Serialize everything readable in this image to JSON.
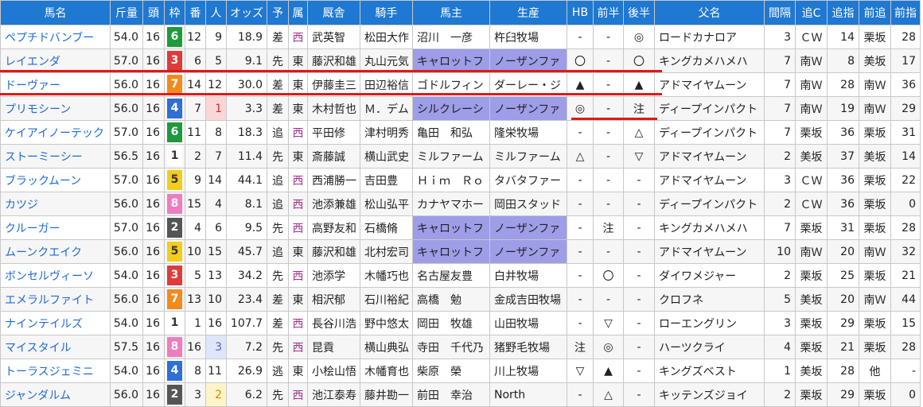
{
  "headers": [
    "馬名",
    "斤量",
    "頭",
    "枠",
    "番",
    "人",
    "オッズ",
    "予",
    "属",
    "厩舎",
    "騎手",
    "馬主",
    "生産",
    "HB",
    "前半",
    "後半",
    "父名",
    "間隔",
    "追C",
    "追指",
    "前追",
    "前指"
  ],
  "frame_colors": {
    "1": {
      "bg": "#ffffff",
      "fg": "#333333"
    },
    "2": {
      "bg": "#555555",
      "fg": "#ffffff"
    },
    "3": {
      "bg": "#e03a3a",
      "fg": "#ffffff"
    },
    "4": {
      "bg": "#2f6fd6",
      "fg": "#ffffff"
    },
    "5": {
      "bg": "#f3cc1c",
      "fg": "#333333"
    },
    "6": {
      "bg": "#1f9a3c",
      "fg": "#ffffff"
    },
    "7": {
      "bg": "#f28b1e",
      "fg": "#ffffff"
    },
    "8": {
      "bg": "#f07cc0",
      "fg": "#ffffff"
    }
  },
  "highlight_color": "#9d9de8",
  "horses": [
    {
      "name": "ペプチドバンブー",
      "kin": "54.0",
      "tou": "16",
      "waku": "6",
      "ban": "12",
      "nin": "9",
      "odds": "18.9",
      "yo": "差",
      "zoku": "西",
      "kyusha": "武英智",
      "kishu": "松田大作",
      "owner": "沼川　一彦",
      "breeder": "杵臼牧場",
      "hb": "-",
      "zen": "-",
      "kou": "◎",
      "sire": "ロードカナロア",
      "kankaku": "3",
      "oic": "ＣＷ",
      "oishi": "14",
      "maeoi": "栗坂",
      "maeshi": "28"
    },
    {
      "name": "レイエンダ",
      "kin": "57.0",
      "tou": "16",
      "waku": "3",
      "ban": "6",
      "nin": "5",
      "odds": "9.1",
      "yo": "先",
      "zoku": "東",
      "kyusha": "藤沢和雄",
      "kishu": "丸山元気",
      "owner": "キャロットフ",
      "breeder": "ノーザンファ",
      "hb": "〇",
      "zen": "-",
      "kou": "〇",
      "sire": "キングカメハメハ",
      "kankaku": "7",
      "oic": "南Ｗ",
      "oishi": "8",
      "maeoi": "美坂",
      "maeshi": "17",
      "hl_owner": true,
      "hl_breeder": true
    },
    {
      "name": "ドーヴァー",
      "kin": "56.0",
      "tou": "16",
      "waku": "7",
      "ban": "14",
      "nin": "12",
      "odds": "30.0",
      "yo": "差",
      "zoku": "東",
      "kyusha": "伊藤圭三",
      "kishu": "田辺裕信",
      "owner": "ゴドルフィン",
      "breeder": "ダーレー・ジ",
      "hb": "▲",
      "zen": "-",
      "kou": "▲",
      "sire": "アドマイヤムーン",
      "kankaku": "7",
      "oic": "南Ｗ",
      "oishi": "28",
      "maeoi": "南Ｗ",
      "maeshi": "36"
    },
    {
      "name": "プリモシーン",
      "kin": "56.0",
      "tou": "16",
      "waku": "4",
      "ban": "7",
      "nin": "1",
      "odds": "3.3",
      "yo": "差",
      "zoku": "東",
      "kyusha": "木村哲也",
      "kishu": "Ｍ．デム",
      "owner": "シルクレーシ",
      "breeder": "ノーザンファ",
      "hb": "◎",
      "zen": "-",
      "kou": "注",
      "sire": "ディープインパクト",
      "kankaku": "7",
      "oic": "南Ｗ",
      "oishi": "19",
      "maeoi": "南Ｗ",
      "maeshi": "29",
      "hl_owner": true,
      "hl_breeder": true
    },
    {
      "name": "ケイアイノーテック",
      "kin": "57.0",
      "tou": "16",
      "waku": "6",
      "ban": "11",
      "nin": "8",
      "odds": "18.3",
      "yo": "追",
      "zoku": "西",
      "kyusha": "平田修",
      "kishu": "津村明秀",
      "owner": "亀田　和弘",
      "breeder": "隆栄牧場",
      "hb": "-",
      "zen": "-",
      "kou": "△",
      "sire": "ディープインパクト",
      "kankaku": "7",
      "oic": "栗坂",
      "oishi": "36",
      "maeoi": "栗坂",
      "maeshi": "31"
    },
    {
      "name": "ストーミーシー",
      "kin": "56.5",
      "tou": "16",
      "waku": "1",
      "ban": "2",
      "nin": "7",
      "odds": "11.4",
      "yo": "先",
      "zoku": "東",
      "kyusha": "斎藤誠",
      "kishu": "横山武史",
      "owner": "ミルファーム",
      "breeder": "ミルファーム",
      "hb": "△",
      "zen": "-",
      "kou": "▽",
      "sire": "アドマイヤムーン",
      "kankaku": "2",
      "oic": "美坂",
      "oishi": "37",
      "maeoi": "美坂",
      "maeshi": "14"
    },
    {
      "name": "ブラックムーン",
      "kin": "57.0",
      "tou": "16",
      "waku": "5",
      "ban": "9",
      "nin": "14",
      "odds": "44.1",
      "yo": "追",
      "zoku": "西",
      "kyusha": "西浦勝一",
      "kishu": "吉田豊",
      "owner": "Ｈｉｍ　Ｒｏ",
      "breeder": "タバタファー",
      "hb": "-",
      "zen": "-",
      "kou": "-",
      "sire": "アドマイヤムーン",
      "kankaku": "3",
      "oic": "ＣＷ",
      "oishi": "36",
      "maeoi": "栗坂",
      "maeshi": "22"
    },
    {
      "name": "カツジ",
      "kin": "56.0",
      "tou": "16",
      "waku": "8",
      "ban": "15",
      "nin": "4",
      "odds": "8.1",
      "yo": "追",
      "zoku": "西",
      "kyusha": "池添兼雄",
      "kishu": "松山弘平",
      "owner": "カナヤマホー",
      "breeder": "岡田スタッド",
      "hb": "-",
      "zen": "-",
      "kou": "-",
      "sire": "ディープインパクト",
      "kankaku": "2",
      "oic": "ＣＷ",
      "oishi": "36",
      "maeoi": "栗坂",
      "maeshi": "0"
    },
    {
      "name": "クルーガー",
      "kin": "57.0",
      "tou": "16",
      "waku": "2",
      "ban": "4",
      "nin": "6",
      "odds": "9.5",
      "yo": "先",
      "zoku": "西",
      "kyusha": "高野友和",
      "kishu": "石橋脩",
      "owner": "キャロットフ",
      "breeder": "ノーザンファ",
      "hb": "-",
      "zen": "注",
      "kou": "-",
      "sire": "キングカメハメハ",
      "kankaku": "7",
      "oic": "栗坂",
      "oishi": "31",
      "maeoi": "栗坂",
      "maeshi": "28",
      "hl_owner": true,
      "hl_breeder": true
    },
    {
      "name": "ムーンクエイク",
      "kin": "56.0",
      "tou": "16",
      "waku": "5",
      "ban": "10",
      "nin": "15",
      "odds": "45.7",
      "yo": "追",
      "zoku": "東",
      "kyusha": "藤沢和雄",
      "kishu": "北村宏司",
      "owner": "キャロットフ",
      "breeder": "ノーザンファ",
      "hb": "-",
      "zen": "-",
      "kou": "-",
      "sire": "アドマイヤムーン",
      "kankaku": "10",
      "oic": "南Ｗ",
      "oishi": "20",
      "maeoi": "南Ｗ",
      "maeshi": "32",
      "hl_owner": true,
      "hl_breeder": true
    },
    {
      "name": "ボンセルヴィーソ",
      "kin": "54.0",
      "tou": "16",
      "waku": "3",
      "ban": "5",
      "nin": "13",
      "odds": "34.2",
      "yo": "先",
      "zoku": "西",
      "kyusha": "池添学",
      "kishu": "木幡巧也",
      "owner": "名古屋友豊",
      "breeder": "白井牧場",
      "hb": "-",
      "zen": "〇",
      "kou": "-",
      "sire": "ダイワメジャー",
      "kankaku": "2",
      "oic": "栗坂",
      "oishi": "25",
      "maeoi": "栗坂",
      "maeshi": "21"
    },
    {
      "name": "エメラルファイト",
      "kin": "56.0",
      "tou": "16",
      "waku": "7",
      "ban": "13",
      "nin": "10",
      "odds": "23.4",
      "yo": "差",
      "zoku": "東",
      "kyusha": "相沢郁",
      "kishu": "石川裕紀",
      "owner": "高橋　勉",
      "breeder": "金成吉田牧場",
      "hb": "-",
      "zen": "-",
      "kou": "-",
      "sire": "クロフネ",
      "kankaku": "5",
      "oic": "美坂",
      "oishi": "20",
      "maeoi": "南Ｗ",
      "maeshi": "44"
    },
    {
      "name": "ナインテイルズ",
      "kin": "54.0",
      "tou": "16",
      "waku": "1",
      "ban": "1",
      "nin": "16",
      "odds": "107.7",
      "yo": "差",
      "zoku": "西",
      "kyusha": "長谷川浩",
      "kishu": "野中悠太",
      "owner": "岡田　牧雄",
      "breeder": "山田牧場",
      "hb": "-",
      "zen": "▽",
      "kou": "-",
      "sire": "ローエングリン",
      "kankaku": "3",
      "oic": "栗坂",
      "oishi": "29",
      "maeoi": "栗坂",
      "maeshi": "15"
    },
    {
      "name": "マイスタイル",
      "kin": "57.5",
      "tou": "16",
      "waku": "8",
      "ban": "16",
      "nin": "3",
      "odds": "7.2",
      "yo": "先",
      "zoku": "西",
      "kyusha": "昆貢",
      "kishu": "横山典弘",
      "owner": "寺田　千代乃",
      "breeder": "猪野毛牧場",
      "hb": "注",
      "zen": "◎",
      "kou": "-",
      "sire": "ハーツクライ",
      "kankaku": "4",
      "oic": "栗坂",
      "oishi": "21",
      "maeoi": "栗坂",
      "maeshi": "28"
    },
    {
      "name": "トーラスジェミニ",
      "kin": "54.0",
      "tou": "16",
      "waku": "4",
      "ban": "8",
      "nin": "11",
      "odds": "26.9",
      "yo": "逃",
      "zoku": "東",
      "kyusha": "小桧山悟",
      "kishu": "木幡育也",
      "owner": "柴原　榮",
      "breeder": "川上牧場",
      "hb": "▽",
      "zen": "▲",
      "kou": "-",
      "sire": "キングズベスト",
      "kankaku": "1",
      "oic": "美坂",
      "oishi": "28",
      "maeoi": "他",
      "maeshi": "-"
    },
    {
      "name": "ジャンダルム",
      "kin": "56.0",
      "tou": "16",
      "waku": "2",
      "ban": "3",
      "nin": "2",
      "odds": "6.2",
      "yo": "先",
      "zoku": "西",
      "kyusha": "池江泰寿",
      "kishu": "藤井勘一",
      "owner": "前田　幸治",
      "breeder": "North",
      "hb": "-",
      "zen": "△",
      "kou": "-",
      "sire": "キッテンズジョイ",
      "kankaku": "2",
      "oic": "栗坂",
      "oishi": "29",
      "maeoi": "栗坂",
      "maeshi": "0"
    }
  ]
}
